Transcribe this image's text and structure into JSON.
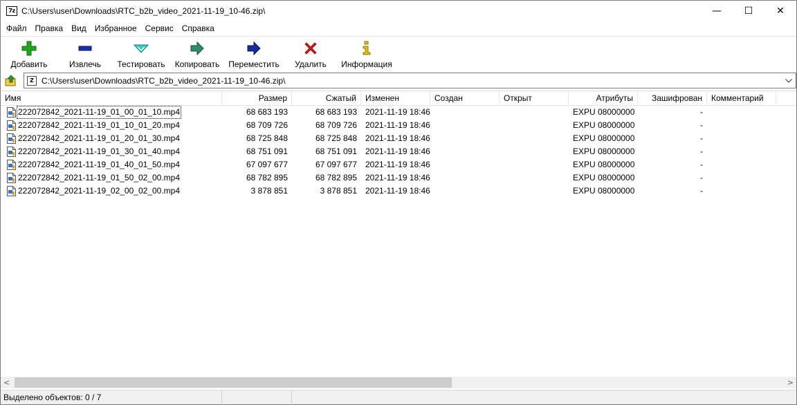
{
  "window": {
    "title": "C:\\Users\\user\\Downloads\\RTC_b2b_video_2021-11-19_10-46.zip\\",
    "app_icon_text": "7z",
    "controls": {
      "minimize": "—",
      "maximize": "☐",
      "close": "✕"
    }
  },
  "menu": [
    "Файл",
    "Правка",
    "Вид",
    "Избранное",
    "Сервис",
    "Справка"
  ],
  "toolbar": [
    {
      "label": "Добавить",
      "icon": "plus-icon",
      "color": "#22a322"
    },
    {
      "label": "Извлечь",
      "icon": "minus-icon",
      "color": "#1b2fa8"
    },
    {
      "label": "Тестировать",
      "icon": "check-triangle-icon",
      "color": "#3fc7c4"
    },
    {
      "label": "Копировать",
      "icon": "copy-arrow-icon",
      "color": "#2f8a70"
    },
    {
      "label": "Переместить",
      "icon": "move-arrow-icon",
      "color": "#1a2a9a"
    },
    {
      "label": "Удалить",
      "icon": "delete-x-icon",
      "color": "#d41a1a"
    },
    {
      "label": "Информация",
      "icon": "info-icon",
      "color": "#d8b000"
    }
  ],
  "address": {
    "path": "C:\\Users\\user\\Downloads\\RTC_b2b_video_2021-11-19_10-46.zip\\",
    "icon_text": "Z"
  },
  "columns": [
    "Имя",
    "Размер",
    "Сжатый",
    "Изменен",
    "Создан",
    "Открыт",
    "Атрибуты",
    "Зашифрован",
    "Комментарий"
  ],
  "files": [
    {
      "name": "222072842_2021-11-19_01_00_01_10.mp4",
      "size": "68 683 193",
      "packed": "68 683 193",
      "modified": "2021-11-19 18:46",
      "created": "",
      "accessed": "",
      "attributes": "EXPU 08000000",
      "encrypted": "-",
      "comment": ""
    },
    {
      "name": "222072842_2021-11-19_01_10_01_20.mp4",
      "size": "68 709 726",
      "packed": "68 709 726",
      "modified": "2021-11-19 18:46",
      "created": "",
      "accessed": "",
      "attributes": "EXPU 08000000",
      "encrypted": "-",
      "comment": ""
    },
    {
      "name": "222072842_2021-11-19_01_20_01_30.mp4",
      "size": "68 725 848",
      "packed": "68 725 848",
      "modified": "2021-11-19 18:46",
      "created": "",
      "accessed": "",
      "attributes": "EXPU 08000000",
      "encrypted": "-",
      "comment": ""
    },
    {
      "name": "222072842_2021-11-19_01_30_01_40.mp4",
      "size": "68 751 091",
      "packed": "68 751 091",
      "modified": "2021-11-19 18:46",
      "created": "",
      "accessed": "",
      "attributes": "EXPU 08000000",
      "encrypted": "-",
      "comment": ""
    },
    {
      "name": "222072842_2021-11-19_01_40_01_50.mp4",
      "size": "67 097 677",
      "packed": "67 097 677",
      "modified": "2021-11-19 18:46",
      "created": "",
      "accessed": "",
      "attributes": "EXPU 08000000",
      "encrypted": "-",
      "comment": ""
    },
    {
      "name": "222072842_2021-11-19_01_50_02_00.mp4",
      "size": "68 782 895",
      "packed": "68 782 895",
      "modified": "2021-11-19 18:46",
      "created": "",
      "accessed": "",
      "attributes": "EXPU 08000000",
      "encrypted": "-",
      "comment": ""
    },
    {
      "name": "222072842_2021-11-19_02_00_02_00.mp4",
      "size": "3 878 851",
      "packed": "3 878 851",
      "modified": "2021-11-19 18:46",
      "created": "",
      "accessed": "",
      "attributes": "EXPU 08000000",
      "encrypted": "-",
      "comment": ""
    }
  ],
  "status": {
    "selected": "Выделено объектов: 0 / 7",
    "size": "",
    "extra": ""
  }
}
